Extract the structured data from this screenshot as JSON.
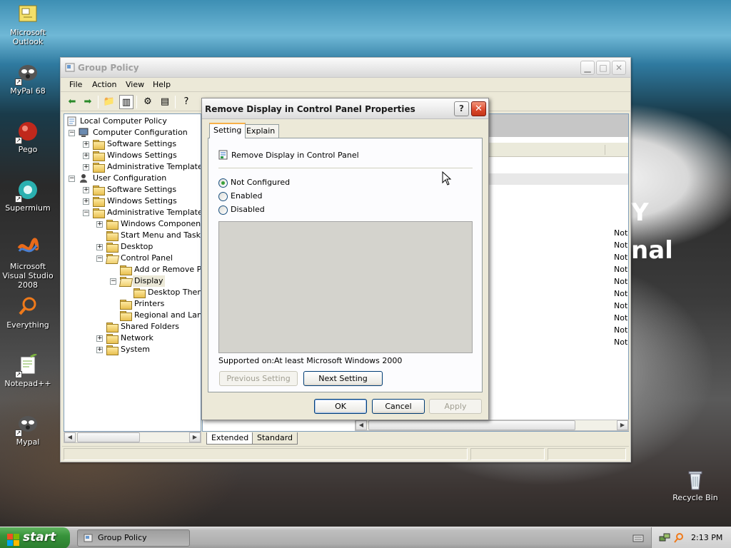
{
  "desktop": {
    "icons": [
      {
        "label": "Microsoft Outlook",
        "icon": "outlook-icon"
      },
      {
        "label": "MyPal 68",
        "icon": "mypal-icon"
      },
      {
        "label": "Pego",
        "icon": "pego-icon"
      },
      {
        "label": "Supermium",
        "icon": "supermium-icon"
      },
      {
        "label": "Microsoft Visual Studio 2008",
        "icon": "visual-studio-icon"
      },
      {
        "label": "Everything",
        "icon": "everything-icon"
      },
      {
        "label": "Notepad++",
        "icon": "notepadpp-icon"
      },
      {
        "label": "Mypal",
        "icon": "mypal-icon"
      },
      {
        "label": "Recycle Bin",
        "icon": "recycle-bin-icon"
      }
    ],
    "background_text": [
      "Y",
      "nal"
    ]
  },
  "gp_window": {
    "title": "Group Policy",
    "menu": [
      "File",
      "Action",
      "View",
      "Help"
    ],
    "tree": {
      "root": "Local Computer Policy",
      "items": [
        "Computer Configuration",
        "Software Settings",
        "Windows Settings",
        "Administrative Templates",
        "User Configuration",
        "Software Settings",
        "Windows Settings",
        "Administrative Templates",
        "Windows Components",
        "Start Menu and Taskba",
        "Desktop",
        "Control Panel",
        "Add or Remove Pro",
        "Display",
        "Desktop Theme",
        "Printers",
        "Regional and Langu",
        "Shared Folders",
        "Network",
        "System"
      ]
    },
    "states": [
      "Not",
      "Not",
      "Not",
      "Not",
      "Not",
      "Not",
      "Not",
      "Not",
      "Not",
      "Not"
    ],
    "bottom_tabs": [
      "Extended",
      "Standard"
    ]
  },
  "dialog": {
    "title": "Remove Display in Control Panel Properties",
    "help_glyph": "?",
    "close_glyph": "✕",
    "tabs": [
      "Setting",
      "Explain"
    ],
    "policy_name": "Remove Display in Control Panel",
    "options": [
      "Not Configured",
      "Enabled",
      "Disabled"
    ],
    "selected_option": "Not Configured",
    "supported_label": "Supported on:",
    "supported_value": "At least Microsoft Windows 2000",
    "prev_button": "Previous Setting",
    "next_button": "Next Setting",
    "ok_button": "OK",
    "cancel_button": "Cancel",
    "apply_button": "Apply"
  },
  "taskbar": {
    "start_label": "start",
    "task_label": "Group Policy",
    "clock": "2:13 PM"
  },
  "colors": {
    "xp_button_border": "#003c74",
    "start_green": "#37933a",
    "close_red": "#d9462a",
    "tab_hot": "#f8b048"
  }
}
